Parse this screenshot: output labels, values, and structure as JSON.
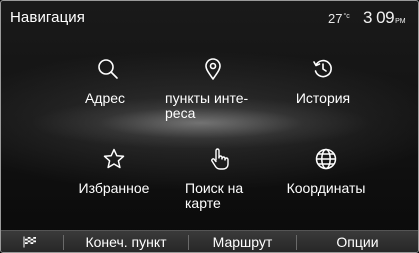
{
  "header": {
    "title": "Навигация",
    "temperature": "27",
    "temperature_unit": "°c",
    "time": "3 09",
    "ampm": "PM"
  },
  "tiles": [
    {
      "icon": "search-icon",
      "label": "Адрес"
    },
    {
      "icon": "location-pin-icon",
      "label_line1": "пункты инте-",
      "label_line2": "реса"
    },
    {
      "icon": "history-icon",
      "label": "История"
    },
    {
      "icon": "star-icon",
      "label": "Избранное"
    },
    {
      "icon": "hand-pointer-icon",
      "label_line1": "Поиск на",
      "label_line2": "карте"
    },
    {
      "icon": "globe-icon",
      "label": "Координаты"
    }
  ],
  "bottom_bar": {
    "flag_icon": "checkered-flag-icon",
    "destination": "Конеч. пункт",
    "route": "Маршрут",
    "options": "Опции"
  }
}
